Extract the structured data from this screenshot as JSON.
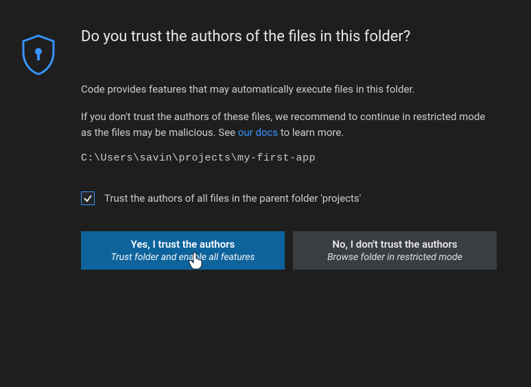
{
  "dialog": {
    "title": "Do you trust the authors of the files in this folder?",
    "paragraph1": "Code provides features that may automatically execute files in this folder.",
    "paragraph2_before_link": "If you don't trust the authors of these files, we recommend to continue in restricted mode as the files may be malicious. See ",
    "paragraph2_link": "our docs",
    "paragraph2_after_link": " to learn more.",
    "path": "C:\\Users\\savin\\projects\\my-first-app",
    "checkbox_label": "Trust the authors of all files in the parent folder 'projects'",
    "checkbox_checked": true,
    "buttons": {
      "trust": {
        "title": "Yes, I trust the authors",
        "subtitle": "Trust folder and enable all features"
      },
      "dont_trust": {
        "title": "No, I don't trust the authors",
        "subtitle": "Browse folder in restricted mode"
      }
    }
  }
}
